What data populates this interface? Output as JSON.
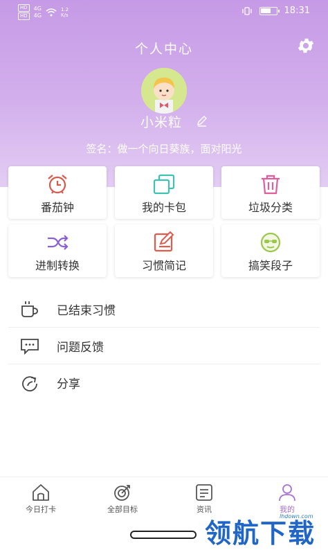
{
  "status_bar": {
    "left_text": [
      "HD",
      "4G",
      "HD",
      "4G"
    ],
    "speed": "1.2\nK/s",
    "time": "18:31",
    "battery_level": 0.7
  },
  "header": {
    "title": "个人中心",
    "nickname": "小米粒",
    "signature": "签名：做一个向日葵族，面对阳光"
  },
  "tools": [
    {
      "label": "番茄钟",
      "icon": "alarm-clock-icon",
      "color": "#d9584d"
    },
    {
      "label": "我的卡包",
      "icon": "card-stack-icon",
      "color": "#3fc0b0"
    },
    {
      "label": "垃圾分类",
      "icon": "trash-can-icon",
      "color": "#e25c9a"
    },
    {
      "label": "进制转换",
      "icon": "shuffle-icon",
      "color": "#8a5fd6"
    },
    {
      "label": "习惯简记",
      "icon": "notebook-pen-icon",
      "color": "#e05a4e"
    },
    {
      "label": "搞笑段子",
      "icon": "sunglasses-face-icon",
      "color": "#9bc84a"
    }
  ],
  "menu": [
    {
      "label": "已结束习惯",
      "icon": "coffee-cup-icon"
    },
    {
      "label": "问题反馈",
      "icon": "feedback-chat-icon"
    },
    {
      "label": "分享",
      "icon": "share-refresh-icon"
    }
  ],
  "tabs": [
    {
      "label": "今日打卡",
      "icon": "home-icon"
    },
    {
      "label": "全部目标",
      "icon": "target-icon"
    },
    {
      "label": "资讯",
      "icon": "news-icon"
    },
    {
      "label": "我的",
      "icon": "profile-icon"
    }
  ],
  "active_tab": "我的",
  "accent_color": "#a86fd6",
  "watermark": {
    "text": "领航下载",
    "site": "lhdown.com"
  }
}
